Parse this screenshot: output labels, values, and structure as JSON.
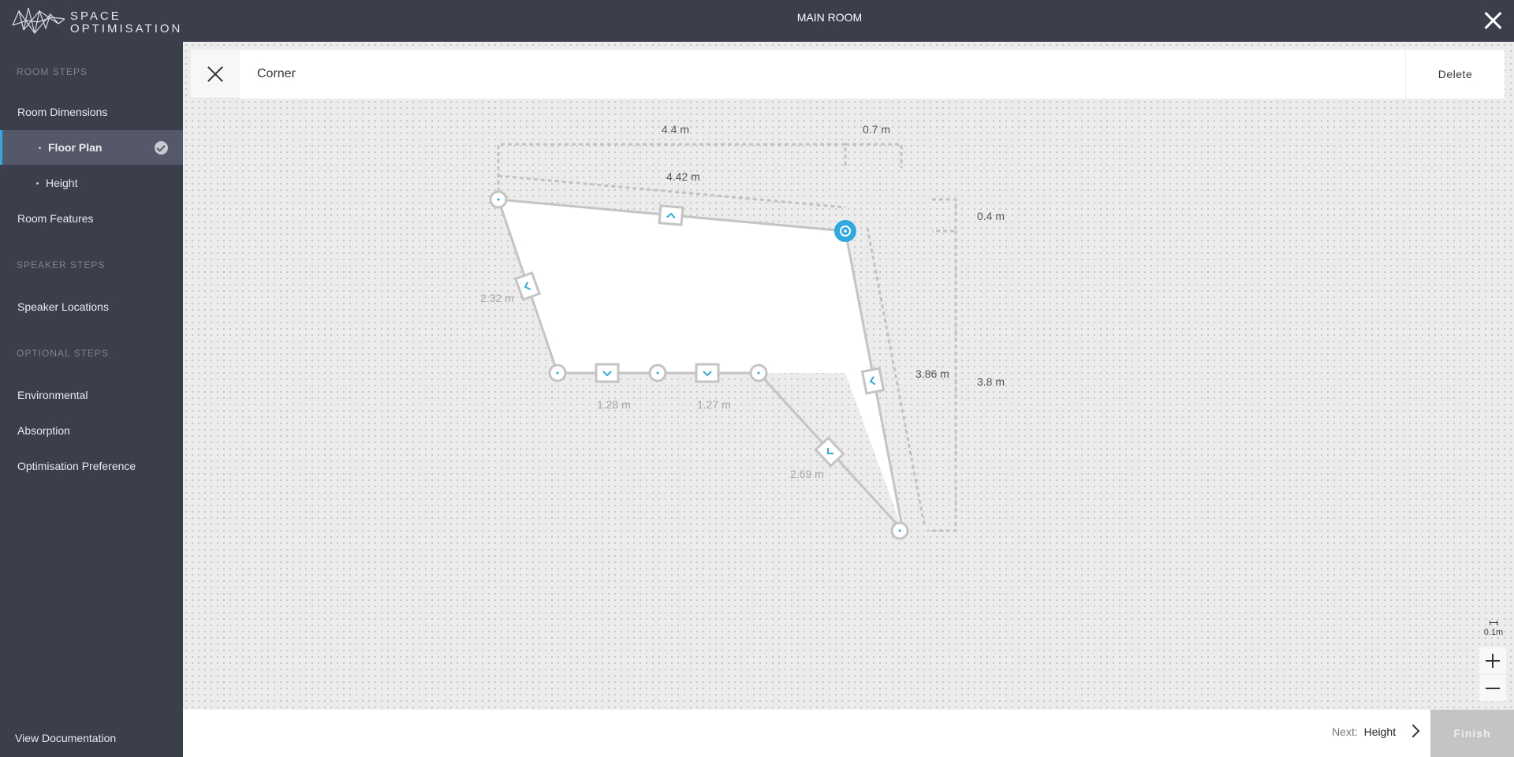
{
  "logo": {
    "line1": "SPACE",
    "line2": "OPTIMISATION"
  },
  "header": {
    "title": "MAIN ROOM"
  },
  "sidebar": {
    "sections": [
      {
        "heading": "ROOM STEPS"
      },
      {
        "heading": "SPEAKER STEPS"
      },
      {
        "heading": "OPTIONAL STEPS"
      }
    ],
    "items": [
      {
        "label": "Room Dimensions"
      },
      {
        "label": "Floor Plan",
        "active": true,
        "completed": true
      },
      {
        "label": "Height"
      },
      {
        "label": "Room Features"
      },
      {
        "label": "Speaker Locations"
      },
      {
        "label": "Environmental"
      },
      {
        "label": "Absorption"
      },
      {
        "label": "Optimisation Preference"
      }
    ],
    "footer_link": "View Documentation"
  },
  "panel": {
    "title": "Corner",
    "delete_label": "Delete"
  },
  "floorplan": {
    "dimensions": {
      "top_overall": "4.4 m",
      "top_offset": "0.7 m",
      "top_wall": "4.42 m",
      "right_offset": "0.4 m",
      "right_overall": "3.8 m",
      "right_wall": "3.86 m",
      "left_wall": "2.32 m",
      "bottom_left": "1.28 m",
      "bottom_mid": "1.27 m",
      "diagonal": "2.69 m"
    },
    "selected_corner_color": "#2fa9e0",
    "accent_color": "#2fa9e0"
  },
  "zoom": {
    "scale_label": "0.1m"
  },
  "footer": {
    "next_label": "Next:",
    "next_step": "Height",
    "finish_label": "Finish"
  }
}
